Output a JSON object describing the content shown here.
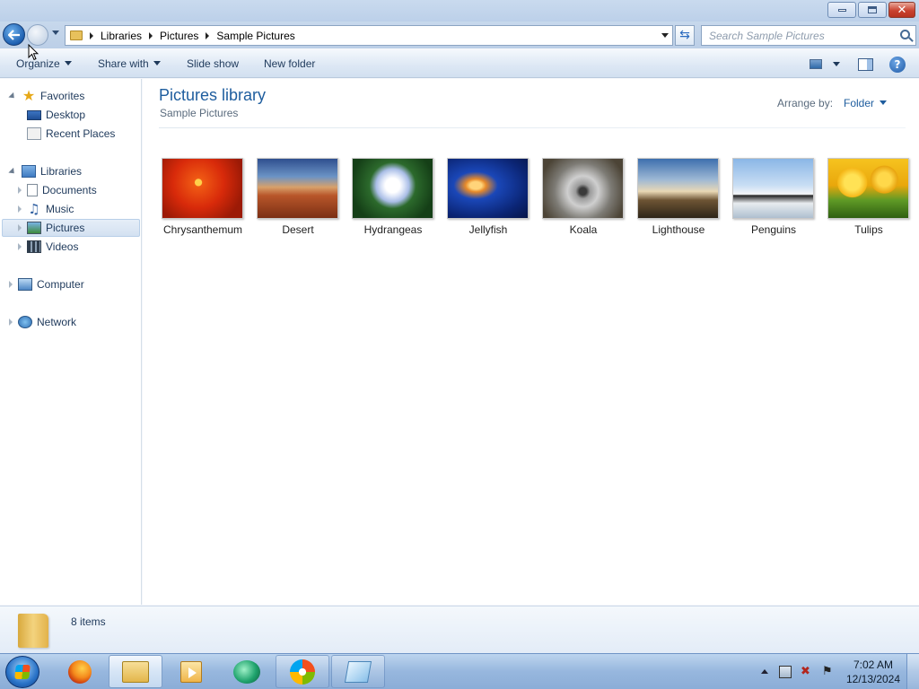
{
  "window": {
    "caption_buttons": {
      "minimize": "minimize",
      "maximize": "restore",
      "close": "close"
    }
  },
  "nav": {
    "breadcrumbs": [
      "Libraries",
      "Pictures",
      "Sample Pictures"
    ],
    "search_placeholder": "Search Sample Pictures"
  },
  "commands": {
    "organize": "Organize",
    "share_with": "Share with",
    "slide_show": "Slide show",
    "new_folder": "New folder"
  },
  "sidebar": {
    "favorites": {
      "label": "Favorites",
      "icon": "star-icon",
      "items": [
        {
          "label": "Desktop",
          "icon": "desktop-icon"
        },
        {
          "label": "Recent Places",
          "icon": "recent-places-icon"
        }
      ]
    },
    "libraries": {
      "label": "Libraries",
      "icon": "libraries-icon",
      "items": [
        {
          "label": "Documents",
          "icon": "documents-icon"
        },
        {
          "label": "Music",
          "icon": "music-icon"
        },
        {
          "label": "Pictures",
          "icon": "pictures-icon",
          "selected": true
        },
        {
          "label": "Videos",
          "icon": "videos-icon"
        }
      ]
    },
    "computer": {
      "label": "Computer",
      "icon": "computer-icon"
    },
    "network": {
      "label": "Network",
      "icon": "network-icon"
    }
  },
  "content": {
    "title": "Pictures library",
    "subtitle": "Sample Pictures",
    "arrange_label": "Arrange by:",
    "arrange_value": "Folder",
    "files": [
      {
        "name": "Chrysanthemum"
      },
      {
        "name": "Desert"
      },
      {
        "name": "Hydrangeas"
      },
      {
        "name": "Jellyfish"
      },
      {
        "name": "Koala"
      },
      {
        "name": "Lighthouse"
      },
      {
        "name": "Penguins"
      },
      {
        "name": "Tulips"
      }
    ]
  },
  "details": {
    "count": "8 items"
  },
  "taskbar": {
    "clock_time": "7:02 AM",
    "clock_date": "12/13/2024",
    "pinned": [
      "firefox-icon",
      "windows-explorer-icon",
      "media-player-icon",
      "green-app-icon",
      "windows-logo-icon",
      "notepad-icon"
    ]
  },
  "colors": {
    "accent": "#1e5d9e",
    "selection": "#d3e1f1",
    "taskbar": "#97b7de"
  }
}
